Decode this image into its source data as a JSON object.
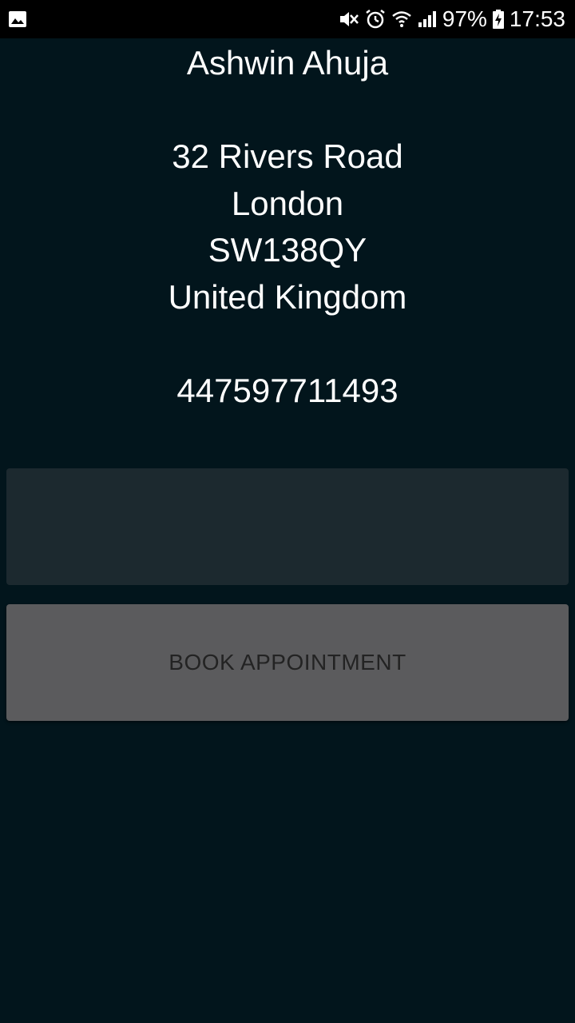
{
  "status_bar": {
    "battery_percent": "97%",
    "time": "17:53",
    "icons": [
      "image-notification-icon",
      "mute-vibrate-icon",
      "alarm-icon",
      "wifi-icon",
      "signal-icon",
      "battery-charging-icon"
    ]
  },
  "contact": {
    "name": "Ashwin Ahuja",
    "address_line1": "32 Rivers Road",
    "city": "London",
    "postcode": "SW138QY",
    "country": "United Kingdom",
    "phone": "447597711493"
  },
  "actions": {
    "book_label": "BOOK APPOINTMENT"
  },
  "colors": {
    "background": "#02151c",
    "panel": "#1c292f",
    "button": "#5b5b5d",
    "button_text": "#232323",
    "text": "#ffffff"
  }
}
